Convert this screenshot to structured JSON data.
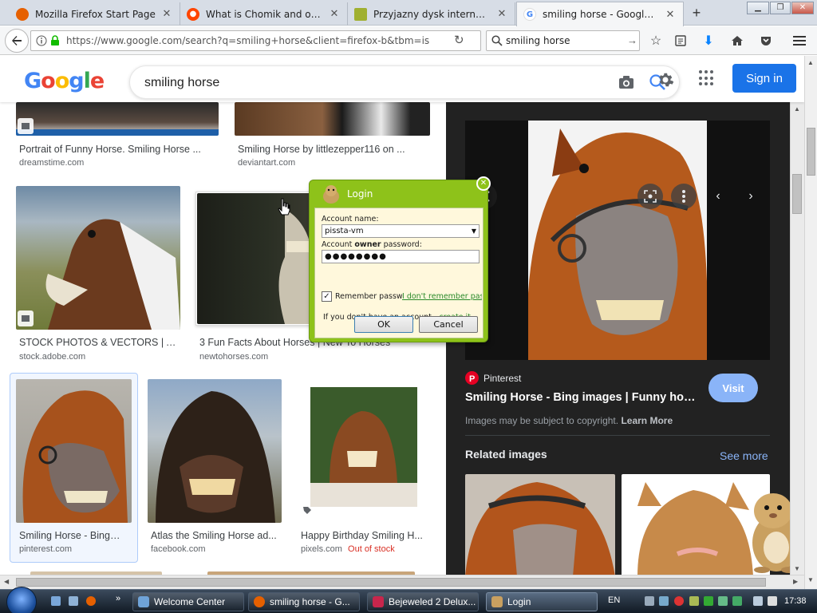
{
  "browser": {
    "tabs": [
      {
        "title": "Mozilla Firefox Start Page",
        "active": false
      },
      {
        "title": "What is Chomik and other ...",
        "active": false
      },
      {
        "title": "Przyjazny dysk internetowy...",
        "active": false
      },
      {
        "title": "smiling horse - Google Sea...",
        "active": true
      }
    ],
    "url": "https://www.google.com/search?q=smiling+horse&client=firefox-b&tbm=isch&sour",
    "search_value": "smiling horse"
  },
  "google": {
    "logo": "Google",
    "query": "smiling horse",
    "signin_label": "Sign in"
  },
  "results": [
    {
      "caption": "Portrait of Funny Horse. Smiling Horse ...",
      "source": "dreamstime.com"
    },
    {
      "caption": "Smiling Horse by littlezepper116 on ...",
      "source": "deviantart.com"
    },
    {
      "caption": "STOCK PHOTOS & VECTORS | Ado...",
      "source": "stock.adobe.com"
    },
    {
      "caption": "3 Fun Facts About Horses | New To Horses",
      "source": "newtohorses.com"
    },
    {
      "caption": "Smiling Horse - Bing i...",
      "source": "pinterest.com"
    },
    {
      "caption": "Atlas the Smiling Horse ad...",
      "source": "facebook.com"
    },
    {
      "caption": "Happy Birthday Smiling H...",
      "source": "pixels.com",
      "status": "Out of stock"
    }
  ],
  "preview": {
    "site": "Pinterest",
    "title": "Smiling Horse - Bing images | Funny hors...",
    "visit_label": "Visit",
    "copyright": "Images may be subject to copyright.",
    "learn_more": "Learn More",
    "related_label": "Related images",
    "see_more": "See more"
  },
  "login_dialog": {
    "title": "Login",
    "account_name_label": "Account name:",
    "account_name_value": "pissta-vm",
    "password_label_pre": "Account ",
    "password_label_bold": "owner",
    "password_label_post": " password:",
    "password_value": "●●●●●●●●",
    "remember_label": "Remember passw",
    "forgot_link": "I don't remember pas",
    "no_account_text": "If you don't have an account - ",
    "create_link": "create it",
    "ok_label": "OK",
    "cancel_label": "Cancel"
  },
  "taskbar": {
    "buttons": [
      "Welcome Center",
      "smiling horse - G...",
      "Bejeweled 2 Delux...",
      "Login"
    ],
    "language": "EN",
    "clock": "17:38"
  },
  "colors": {
    "google_blue": "#1a73e8",
    "preview_bg": "#222222",
    "dialog_green": "#8ec21a",
    "visit_blue": "#8ab4f8"
  }
}
